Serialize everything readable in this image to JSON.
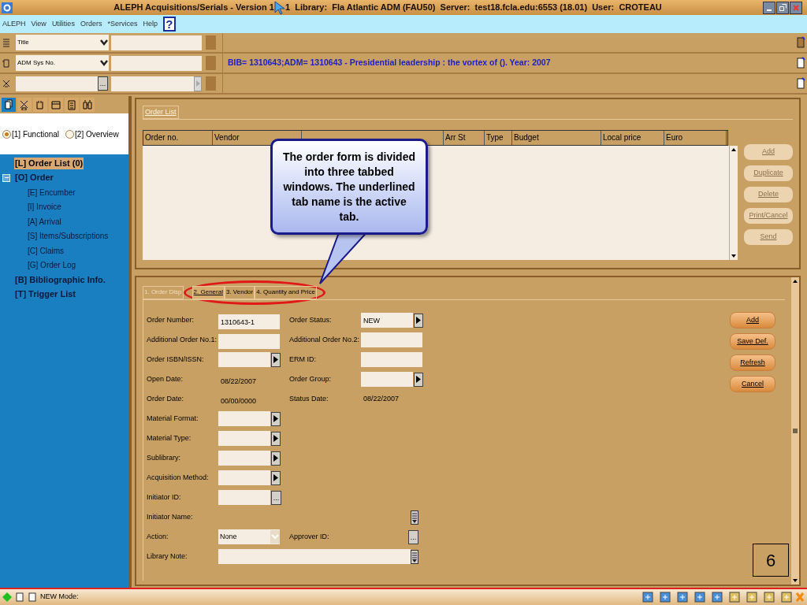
{
  "window": {
    "title_before_cursor": "ALEPH Acquisitions/Serials - Version 1",
    "title_after_cursor": "1  Library:  Fla Atlantic ADM (FAU50)  Server:  test18.fcla.edu:6553 (18.01)  User:  CROTEAU"
  },
  "menu": [
    "ALEPH",
    "View",
    "Utilities",
    "Orders",
    "*Services",
    "Help"
  ],
  "help_button": "?",
  "search_rows": [
    {
      "kind": "select",
      "value": "Title"
    },
    {
      "kind": "select",
      "value": "ADM Sys No.",
      "record": "BIB= 1310643;ADM= 1310643 - Presidential leadership : the vortex of (). Year: 2007"
    },
    {
      "kind": "lookup",
      "lookup_button": "..."
    }
  ],
  "sidebar": {
    "toolbar": [
      {
        "selected": true
      },
      {
        "selected": false
      },
      {
        "selected": false
      },
      {
        "selected": false
      },
      {
        "selected": false
      },
      {
        "selected": false
      }
    ],
    "views": [
      {
        "label": "[1] Functional",
        "selected": true
      },
      {
        "label": "[2] Overview",
        "selected": false
      }
    ],
    "items": [
      {
        "label": "[L] Order List (0)",
        "selected": true
      },
      {
        "label": "[O] Order",
        "selected": false,
        "expanded": true,
        "children": [
          {
            "label": "[E] Encumber",
            "selected": false
          },
          {
            "label": "[I] Invoice",
            "selected": false
          },
          {
            "label": "[A] Arrival",
            "selected": false
          },
          {
            "label": "[S] Items/Subscriptions",
            "selected": false
          },
          {
            "label": "[C] Claims",
            "selected": false
          },
          {
            "label": "[G] Order Log",
            "selected": false
          }
        ]
      },
      {
        "label": "[B] Bibliographic Info.",
        "selected": false
      },
      {
        "label": "[T] Trigger List",
        "selected": false
      }
    ]
  },
  "order_list": {
    "tab": {
      "label": "Order List",
      "selected": true
    },
    "columns": [
      "Order no.",
      "Vendor",
      "Arr St",
      "Type",
      "Budget",
      "Local price",
      "Euro"
    ],
    "buttons": [
      {
        "label": "Add",
        "disabled": true
      },
      {
        "label": "Duplicate",
        "disabled": true
      },
      {
        "label": "Delete",
        "disabled": true
      },
      {
        "label": "Print/Cancel",
        "disabled": true
      },
      {
        "label": "Send",
        "disabled": true
      }
    ]
  },
  "order_form": {
    "tabs": [
      {
        "label": "1. Order Disp",
        "selected": false,
        "disabled": true
      },
      {
        "label": "2. General",
        "selected": true,
        "disabled": false
      },
      {
        "label": "3. Vendor",
        "selected": false,
        "disabled": false
      },
      {
        "label": "4. Quantity and Price",
        "selected": false,
        "disabled": false
      }
    ],
    "rows": [
      {
        "left": {
          "label": "Order Number:",
          "value": "1310643-1",
          "kind": "text"
        },
        "right": {
          "label": "Order Status:",
          "value": "NEW",
          "kind": "select"
        }
      },
      {
        "left": {
          "label": "Additional Order No.1:",
          "kind": "text"
        },
        "right": {
          "label": "Additional Order No.2:",
          "kind": "text"
        }
      },
      {
        "left": {
          "label": "Order ISBN/ISSN:",
          "kind": "select"
        },
        "right": {
          "label": "ERM ID:",
          "kind": "text"
        }
      },
      {
        "left": {
          "label": "Open Date:",
          "value": "08/22/2007",
          "kind": "display"
        },
        "right": {
          "label": "Order Group:",
          "kind": "select"
        }
      },
      {
        "left": {
          "label": "Order Date:",
          "value": "00/00/0000",
          "kind": "display"
        },
        "right": {
          "label": "Status Date:",
          "value": "08/22/2007",
          "kind": "display"
        }
      },
      {
        "left": {
          "label": "Material Format:",
          "kind": "select"
        }
      },
      {
        "left": {
          "label": "Material Type:",
          "kind": "select"
        }
      },
      {
        "left": {
          "label": "Sublibrary:",
          "kind": "select"
        }
      },
      {
        "left": {
          "label": "Acquisition Method:",
          "kind": "select"
        }
      },
      {
        "left": {
          "label": "Initiator ID:",
          "kind": "lookup",
          "button": "..."
        }
      },
      {
        "left": {
          "label": "Initiator Name:",
          "kind": "wide_display"
        }
      },
      {
        "left": {
          "label": "Action:",
          "value": "None",
          "kind": "dropdown"
        },
        "right": {
          "label": "Approver ID:",
          "kind": "lookup_display",
          "button": "..."
        }
      },
      {
        "left": {
          "label": "Library Note:",
          "kind": "wide_note"
        }
      }
    ],
    "buttons": [
      {
        "label": "Add",
        "disabled": false
      },
      {
        "label": "Save Def.",
        "disabled": false
      },
      {
        "label": "Refresh",
        "disabled": false
      },
      {
        "label": "Cancel",
        "disabled": false
      }
    ]
  },
  "callout": "The order form is divided into three tabbed windows. The underlined tab name is the active tab.",
  "slide_number": "6",
  "status_bar": {
    "mode": "NEW Mode:"
  }
}
